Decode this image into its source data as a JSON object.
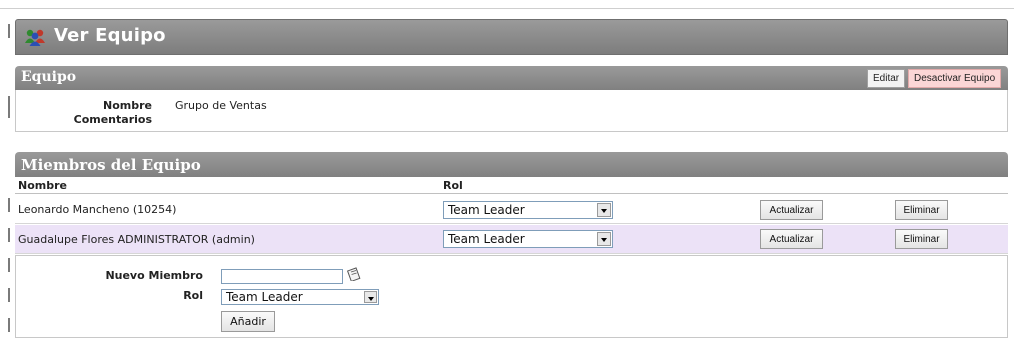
{
  "page": {
    "title": "Ver Equipo"
  },
  "team_panel": {
    "title": "Equipo",
    "edit_label": "Editar",
    "deactivate_label": "Desactivar Equipo",
    "name_label": "Nombre",
    "name_value": "Grupo de Ventas",
    "comments_label": "Comentarios",
    "comments_value": ""
  },
  "members_panel": {
    "title": "Miembros del Equipo",
    "columns": {
      "name": "Nombre",
      "role": "Rol"
    },
    "rows": [
      {
        "name": "Leonardo Mancheno (10254)",
        "role": "Team Leader",
        "update_label": "Actualizar",
        "remove_label": "Eliminar"
      },
      {
        "name": "Guadalupe Flores ADMINISTRATOR (admin)",
        "role": "Team Leader",
        "update_label": "Actualizar",
        "remove_label": "Eliminar"
      }
    ]
  },
  "add_member": {
    "new_member_label": "Nuevo Miembro",
    "new_member_value": "",
    "role_label": "Rol",
    "role_value": "Team Leader",
    "add_label": "Añadir"
  },
  "icons": {
    "title": "team-people-icon",
    "lookup": "address-book-icon"
  },
  "colors": {
    "header_gray": "#8c8c8c",
    "alt_row": "#ece2f7",
    "danger_button": "#fbd6d6"
  }
}
